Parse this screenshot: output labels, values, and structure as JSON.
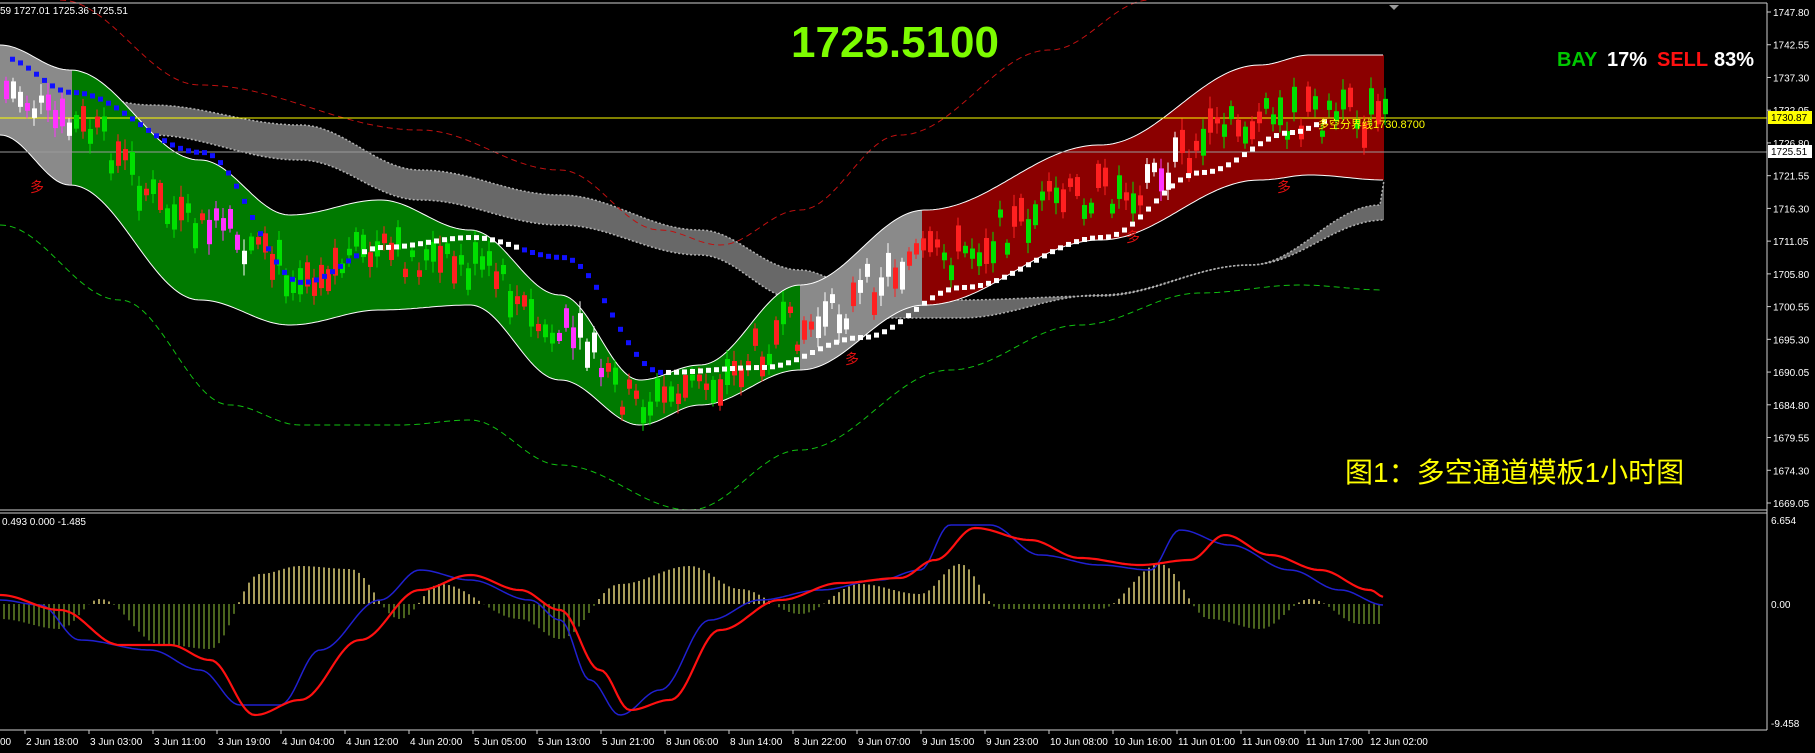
{
  "window": {
    "ohlc_info": "59 1727.01 1725.36 1725.51",
    "indicator_info": "0.493 0.000 -1.485"
  },
  "main_chart": {
    "current_price_display": "1725.5100",
    "sentiment": {
      "buy_label": "BAY",
      "buy_pct": "17%",
      "sell_label": "SELL",
      "sell_pct": "83%"
    },
    "divider_label": "多空分界线1730.8700",
    "caption": "图1：多空通道模板1小时图",
    "signal_marks": [
      "多",
      "多",
      "多",
      "多"
    ],
    "price_axis_ticks": [
      "1747.80",
      "1742.55",
      "1737.30",
      "1732.05",
      "1726.80",
      "1721.55",
      "1716.30",
      "1711.05",
      "1705.80",
      "1700.55",
      "1695.30",
      "1690.05",
      "1684.80",
      "1679.55",
      "1674.30",
      "1669.05"
    ],
    "price_tag_divider": "1730.87",
    "price_tag_current": "1725.51",
    "colors": {
      "bull_channel": "#007a00",
      "bear_channel": "#8b0000",
      "neutral_channel": "#8a8a8a",
      "gray_band": "#6e6e6e",
      "big_price": "#7cfc00",
      "buy": "#00c800",
      "sell": "#ff1010",
      "divider": "#ffff00"
    }
  },
  "sub_chart": {
    "axis_ticks": [
      "6.654",
      "0.00",
      "-9.458"
    ]
  },
  "time_axis_labels": [
    "2 Jun 18:00",
    "3 Jun 03:00",
    "3 Jun 11:00",
    "3 Jun 19:00",
    "4 Jun 04:00",
    "4 Jun 12:00",
    "4 Jun 20:00",
    "5 Jun 05:00",
    "5 Jun 13:00",
    "5 Jun 21:00",
    "8 Jun 06:00",
    "8 Jun 14:00",
    "8 Jun 22:00",
    "9 Jun 07:00",
    "9 Jun 15:00",
    "9 Jun 23:00",
    "10 Jun 08:00",
    "10 Jun 16:00",
    "11 Jun 01:00",
    "11 Jun 09:00",
    "11 Jun 17:00",
    "12 Jun 02:00"
  ],
  "time_axis_first_label": "00"
}
